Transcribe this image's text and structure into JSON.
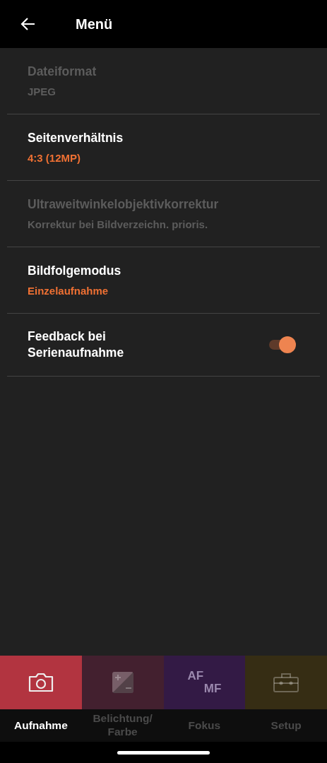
{
  "header": {
    "title": "Menü"
  },
  "items": [
    {
      "kind": "value",
      "label": "Dateiformat",
      "value": "JPEG",
      "disabled": true
    },
    {
      "kind": "value",
      "label": "Seitenverhältnis",
      "value": "4:3 (12MP)",
      "disabled": false
    },
    {
      "kind": "value",
      "label": "Ultraweitwinkelobjektivkorrektur",
      "value": "Korrektur bei Bildverzeichn. prioris.",
      "disabled": true
    },
    {
      "kind": "value",
      "label": "Bildfolgemodus",
      "value": "Einzelaufnahme",
      "disabled": false
    },
    {
      "kind": "toggle",
      "label": "Feedback bei Serienaufnahme",
      "on": true,
      "disabled": false
    }
  ],
  "tabs": [
    {
      "kind": "camera",
      "label": "Aufnahme",
      "color": "#b23440",
      "selected": true
    },
    {
      "kind": "exposure",
      "label": "Belichtung/ Farbe",
      "color": "#43202f",
      "selected": false
    },
    {
      "kind": "letters",
      "icon_texts": [
        "AF",
        "MF"
      ],
      "label": "Fokus",
      "color": "#331a45",
      "selected": false
    },
    {
      "kind": "toolbox",
      "label": "Setup",
      "color": "#362d14",
      "selected": false
    }
  ]
}
